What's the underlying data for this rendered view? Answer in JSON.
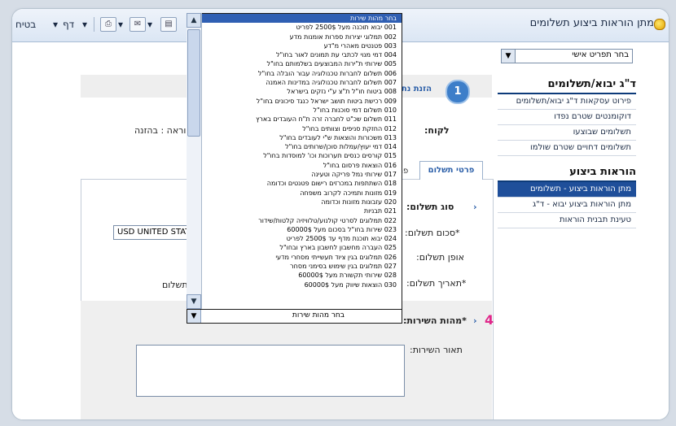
{
  "browser": {
    "title": "מתן הוראות ביצוע תשלומים",
    "toolbar": {
      "page_label": "דף",
      "safety_label": "בטיח"
    }
  },
  "sidebar": {
    "personal_menu_select": "בחר תפריט אישי",
    "section1_title": "ד\"ג יבוא/תשלומים",
    "section1_items": [
      "פירוט עסקאות ד\"ג יבוא/תשלומים",
      "דוקומנטים שטרם נפדו",
      "תשלומים שבוצעו",
      "תשלומים דחויים שטרם שולמו"
    ],
    "section2_title": "הוראות ביצוע",
    "section2_items": [
      {
        "label": "מתן הוראות ביצוע - תשלומים",
        "active": true
      },
      {
        "label": "מתן הוראות ביצוע יבוא - ד\"ג",
        "active": false
      },
      {
        "label": "טעינת תבנית הוראות",
        "active": false
      }
    ]
  },
  "content": {
    "step_number": "1",
    "step_label": "הזנת נתונים",
    "customer_label": "לקוח:",
    "instruction_label": "הוראה : בהזנה",
    "tab_active": "פרטי תשלום",
    "tab_other": "פרטי",
    "fields": {
      "payment_type": "סוג תשלום:",
      "payment_amount": "*סכום תשלום:",
      "payment_method": "אופן תשלום:",
      "payment_date": "*תאריך תשלום:",
      "payment_date_extra": "תשלום",
      "service_nature": "*מהות השירות:",
      "service_description": "תאור השירות:"
    },
    "currency_value": "USD UNITED STATES",
    "step_callout": "4"
  },
  "dropdown": {
    "selected_value": "בחר מהות שירות",
    "options": [
      "בחר מהות שירות",
      "001 יבוא תוכנה מעל 2500$ לפריט",
      "002 תמלוגי יצירות ספרות אומנות מדע",
      "003 פטנטים מאהרי מ\"דע",
      "004 דמי מנוי לכתבי עת תמונים לאור בחו\"ל",
      "005 שירותי ת\"ירות המבוצעים בשלמותם בחו\"ל",
      "006 תשלום לחברות טכנולוגיה עבור הובלה בחו\"ל",
      "007 תשלום לחברות טכנולוגיה במדינות האמנה",
      "008 ביטוח חו\"ל ת\"צ ע\"י נזקים בישראל",
      "009 רכישת ביטוח תושב ישראל כנגד סיכונים בחו\"ל",
      "010 תשלום דמי סוכנות בחו\"ל",
      "011 תשלום שכ\"ט לחברה זרה ת\"ח העובדים בארץ",
      "012 החזקת סניפים וצוותים בחו\"ל",
      "013 משכורות והוצאות ש\"י לעובדים בחו\"ל",
      "014 דמי יעוץ/עמלות סוכן/שרותים בחו\"ל",
      "015 קורסים כנסים תערוכות וכו' למוסדות בחו\"ל",
      "016 הוצאות פרסום בחו\"ל",
      "017 שירותי נמל פריקה וטעינה",
      "018 השתתפות במכרזים רישום פטנטים וכדומה",
      "019 מזונות ותמיכה לקרוב משפחה",
      "020 עזבונות מזונות וכדומה",
      "021 תבניות",
      "022 תמלוגים לסרטי קולנוע/טלוויזיה קלטות/שידור",
      "023 שירות בחו\"ל בסכום מעל 60000$",
      "024 יבוא תוכנת מדף עד 2500$ לפריט",
      "025 העברה מחשבון לחשבון בארץ ובחו\"ל",
      "026 תמלוגים בגין ציוד תעשייתי מסחרי מדעי",
      "027 תמלוגים בגין שימוש בסימני מסחר",
      "028 שירותי תקשורת מעל 60000$",
      "030 הוצאות שיווק מעל 60000$"
    ]
  }
}
